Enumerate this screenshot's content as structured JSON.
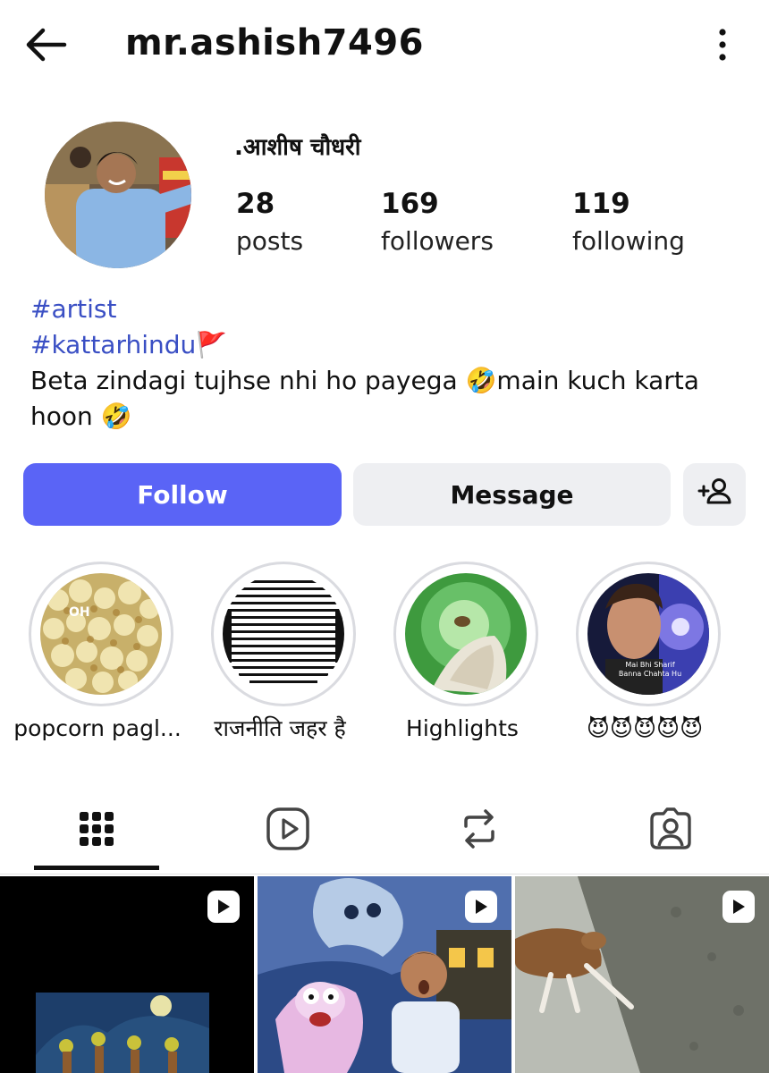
{
  "header": {
    "username": "mr.ashish7496",
    "back_icon": "arrow-left-icon",
    "more_icon": "more-vertical-icon"
  },
  "profile": {
    "display_name": ".आशीष चौधरी",
    "stats": [
      {
        "value": "28",
        "label": "posts"
      },
      {
        "value": "169",
        "label": "followers"
      },
      {
        "value": "119",
        "label": "following"
      }
    ],
    "bio": {
      "tag1": "#artist",
      "tag2": "#kattarhindu🚩",
      "text": " Beta zindagi tujhse nhi ho payega 🤣main kuch karta hoon 🤣"
    }
  },
  "actions": {
    "follow_label": "Follow",
    "message_label": "Message",
    "add_person_icon": "add-person-icon"
  },
  "highlights": [
    {
      "caption": "popcorn pagl...",
      "overlay": "OH"
    },
    {
      "caption": "राजनीति जहर है"
    },
    {
      "caption": "Highlights"
    },
    {
      "caption": "😈😈😈😈😈",
      "overlay": "Mai Bhi Sharif\nBanna Chahta Hu"
    }
  ],
  "tabs": [
    "grid-icon",
    "reels-icon",
    "reposts-icon",
    "tagged-icon"
  ],
  "colors": {
    "accent": "#5a64f6",
    "hashtag": "#3a4fc4",
    "secondary_button": "#eeeff2"
  }
}
